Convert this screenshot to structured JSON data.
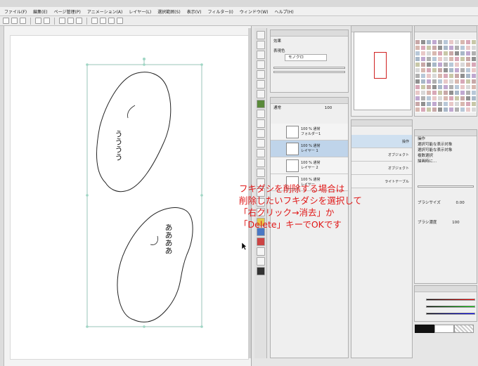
{
  "menu": {
    "items": [
      "ファイル(F)",
      "編集(E)",
      "ページ管理(P)",
      "アニメーション(A)",
      "レイヤー(L)",
      "選択範囲(S)",
      "表示(V)",
      "フィルター(I)",
      "ウィンドウ(W)",
      "ヘルプ(H)"
    ]
  },
  "caption": {
    "line1": "フキダシを削除する場合は",
    "line2": "削除したいフキダシを選択して",
    "line3": "「右クリック→消去」か",
    "line4": "「Delete」キーでOKです"
  },
  "balloons": {
    "top_text": "うううう",
    "bottom_text": "ああああ"
  },
  "tool_property": {
    "title": "効果",
    "label": "表現色",
    "value": "モノクロ"
  },
  "layer_panel": {
    "blend_mode": "通常",
    "opacity": "100",
    "layers": [
      {
        "name": "フォルダー1",
        "mode": "100 % 通常"
      },
      {
        "name": "レイヤー 1",
        "mode": "100 % 通常"
      },
      {
        "name": "レイヤー 2",
        "mode": "100 % 通常"
      },
      {
        "name": "レイヤー",
        "mode": "100 % 通常"
      }
    ]
  },
  "subtool": {
    "items": [
      "操作",
      "オブジェクト",
      "オブジェクト",
      "ライトテーブル"
    ]
  },
  "right_panel": {
    "rows": [
      "操作",
      "選択可能な表示対象",
      "選択可能な表示対象",
      "複数選択",
      "描画時に..."
    ],
    "size_label": "ブラシサイズ",
    "size_value": "0.00",
    "density_label": "ブラシ濃度",
    "density_value": "100"
  },
  "colors": {
    "caption": "#e01818",
    "selection": "#bfd4ea",
    "navigator_rect": "#d02020"
  }
}
